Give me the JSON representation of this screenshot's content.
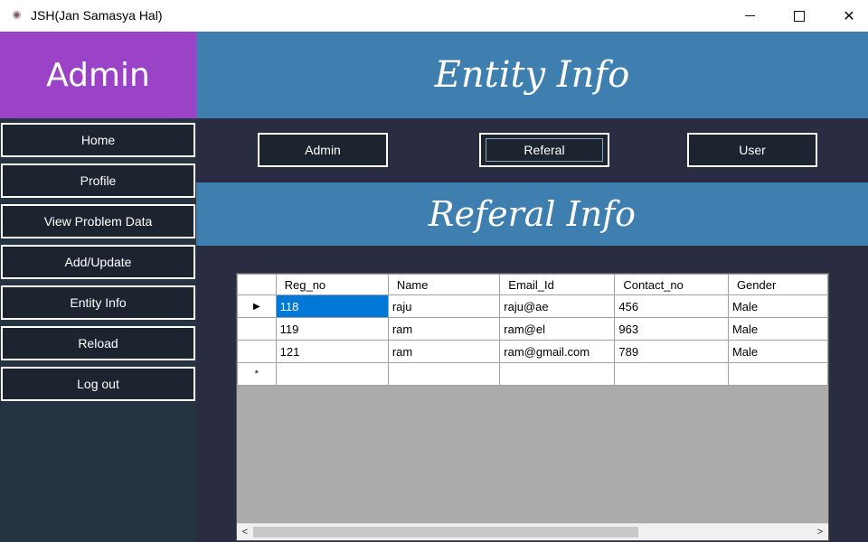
{
  "window": {
    "title": "JSH(Jan Samasya Hal)"
  },
  "sidebar": {
    "brand": "Admin",
    "items": [
      {
        "label": "Home"
      },
      {
        "label": "Profile"
      },
      {
        "label": "View Problem Data"
      },
      {
        "label": "Add/Update"
      },
      {
        "label": "Entity Info"
      },
      {
        "label": "Reload"
      },
      {
        "label": "Log out"
      }
    ]
  },
  "main": {
    "banner_title": "Entity Info",
    "tabs": [
      {
        "label": "Admin"
      },
      {
        "label": "Referal",
        "active": true
      },
      {
        "label": "User"
      }
    ],
    "section_title": "Referal Info",
    "grid": {
      "columns": [
        "Reg_no",
        "Name",
        "Email_Id",
        "Contact_no",
        "Gender"
      ],
      "rows": [
        [
          "118",
          "raju",
          "raju@ae",
          "456",
          "Male"
        ],
        [
          "119",
          "ram",
          "ram@el",
          "963",
          "Male"
        ],
        [
          "121",
          "ram",
          "ram@gmail.com",
          "789",
          "Male"
        ]
      ],
      "current_row_marker": "▶",
      "new_row_marker": "*"
    }
  },
  "colors": {
    "brand_bg": "#9b43c6",
    "banner_bg": "#3f7fb0",
    "sidebar_bg": "#263340",
    "main_bg": "#2a2d42",
    "selected_cell": "#0078d7"
  }
}
